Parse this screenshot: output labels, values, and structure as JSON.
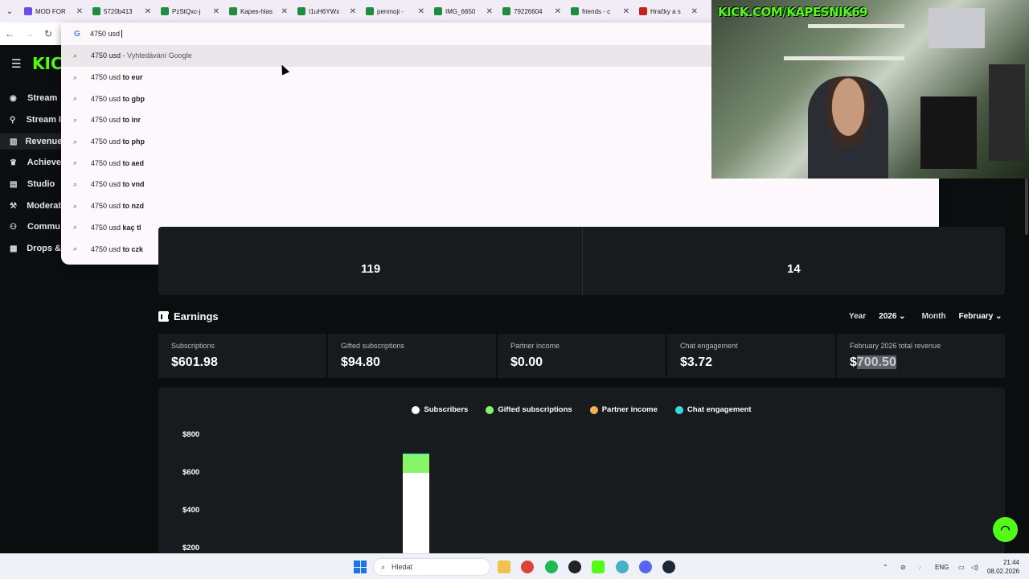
{
  "browser": {
    "tabs": [
      {
        "label": "MOD FOR",
        "color": "#6b4ce6"
      },
      {
        "label": "5720b413",
        "color": "#1e8e3e"
      },
      {
        "label": "PzStQxc-j",
        "color": "#1e8e3e"
      },
      {
        "label": "Kapes-hlas",
        "color": "#1e8e3e"
      },
      {
        "label": "I1uH6YWx",
        "color": "#1e8e3e"
      },
      {
        "label": "penmoji -",
        "color": "#1e8e3e"
      },
      {
        "label": "IMG_6650",
        "color": "#1e8e3e"
      },
      {
        "label": "79226604",
        "color": "#1e8e3e"
      },
      {
        "label": "friends - c",
        "color": "#1e8e3e"
      },
      {
        "label": "Hračky a s",
        "color": "#c5221f"
      }
    ],
    "omnibox": {
      "query": "4750 usd",
      "suggestions": [
        {
          "prefix": "4750 usd",
          "bold": "",
          "desc": "Vyhledávání Google",
          "sep": " - "
        },
        {
          "prefix": "4750 usd ",
          "bold": "to eur",
          "desc": "",
          "sep": ""
        },
        {
          "prefix": "4750 usd ",
          "bold": "to gbp",
          "desc": "",
          "sep": ""
        },
        {
          "prefix": "4750 usd ",
          "bold": "to inr",
          "desc": "",
          "sep": ""
        },
        {
          "prefix": "4750 usd ",
          "bold": "to php",
          "desc": "",
          "sep": ""
        },
        {
          "prefix": "4750 usd ",
          "bold": "to aed",
          "desc": "",
          "sep": ""
        },
        {
          "prefix": "4750 usd ",
          "bold": "to vnd",
          "desc": "",
          "sep": ""
        },
        {
          "prefix": "4750 usd ",
          "bold": "to nzd",
          "desc": "",
          "sep": ""
        },
        {
          "prefix": "4750 usd ",
          "bold": "kaç tl",
          "desc": "",
          "sep": ""
        },
        {
          "prefix": "4750 usd ",
          "bold": "to czk",
          "desc": "",
          "sep": ""
        }
      ]
    }
  },
  "kick": {
    "logo": "KICK",
    "sidebar": [
      {
        "label": "Stream",
        "icon": "stream-icon"
      },
      {
        "label": "Stream I",
        "icon": "link-icon"
      },
      {
        "label": "Revenue",
        "icon": "chart-icon",
        "active": true
      },
      {
        "label": "Achieve",
        "icon": "trophy-icon"
      },
      {
        "label": "Studio",
        "icon": "studio-icon"
      },
      {
        "label": "Moderat",
        "icon": "hammer-icon"
      },
      {
        "label": "Commu",
        "icon": "people-icon"
      },
      {
        "label": "Drops &",
        "icon": "drops-icon"
      }
    ],
    "stats": {
      "left_value": "119",
      "right_value": "14"
    },
    "earnings": {
      "title": "Earnings",
      "year_label": "Year",
      "year_value": "2026",
      "month_label": "Month",
      "month_value": "February",
      "cards": [
        {
          "label": "Subscriptions",
          "value": "$601.98"
        },
        {
          "label": "Gifted subscriptions",
          "value": "$94.80"
        },
        {
          "label": "Partner income",
          "value": "$0.00"
        },
        {
          "label": "Chat engagement",
          "value": "$3.72"
        },
        {
          "label": "February 2026 total revenue",
          "value_prefix": "$",
          "value_highlight": "700.50"
        }
      ]
    },
    "help_icon": "headset-icon"
  },
  "chart_data": {
    "type": "bar",
    "stacked": true,
    "series": [
      {
        "name": "Subscribers",
        "color": "#ffffff",
        "values": [
          601.98
        ]
      },
      {
        "name": "Gifted subscriptions",
        "color": "#86f56a",
        "values": [
          94.8
        ]
      },
      {
        "name": "Partner income",
        "color": "#f2b255",
        "values": [
          0
        ]
      },
      {
        "name": "Chat engagement",
        "color": "#39d8e0",
        "values": [
          3.72
        ]
      }
    ],
    "yticks": [
      "$800",
      "$600",
      "$400",
      "$200"
    ],
    "ylim": [
      0,
      800
    ],
    "legend_position": "top-center"
  },
  "webcam": {
    "banner": "KICK.COM/KAPESNIK69"
  },
  "taskbar": {
    "search_placeholder": "Hledat",
    "lang": "ENG",
    "time": "21:44",
    "date": "08.02.2026"
  }
}
